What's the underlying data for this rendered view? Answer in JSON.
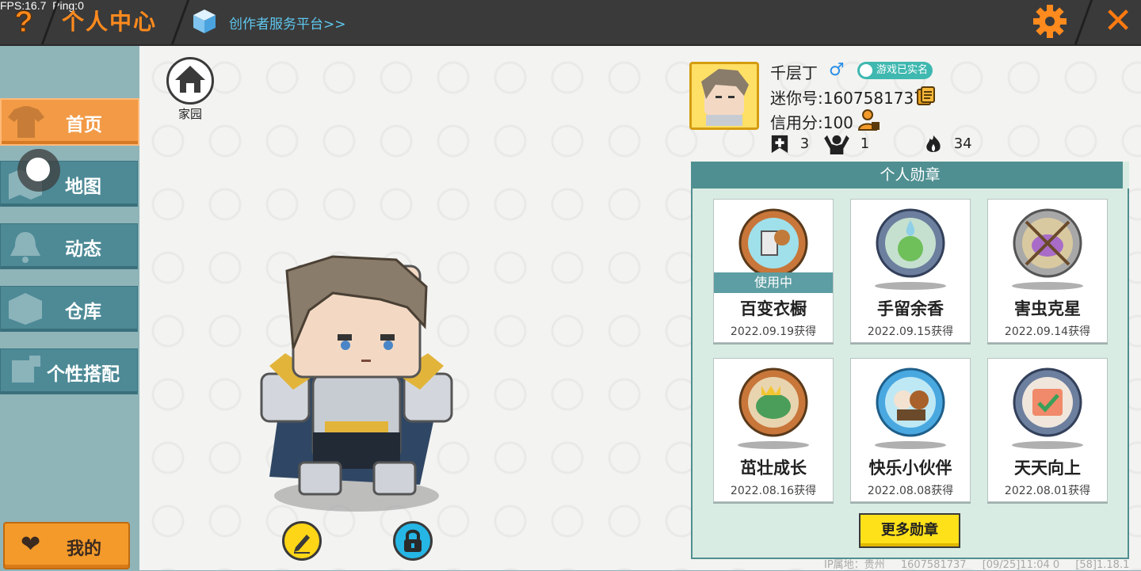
{
  "debug": {
    "fps": "FPS:16.7",
    "ping": "Ping:0"
  },
  "header": {
    "help_label": "?",
    "title": "个人中心",
    "creator_link": "创作者服务平台>>",
    "close_label": "✕"
  },
  "sidebar": {
    "items": [
      {
        "label": "首页",
        "icon": "shirt-icon",
        "active": true
      },
      {
        "label": "地图",
        "icon": "map-icon",
        "active": false
      },
      {
        "label": "动态",
        "icon": "bell-icon",
        "active": false
      },
      {
        "label": "仓库",
        "icon": "box-icon",
        "active": false
      },
      {
        "label": "个性搭配",
        "icon": "outfit-icon",
        "active": false
      }
    ],
    "my_label": "我的"
  },
  "stage": {
    "home_label": "家园",
    "edit_icon": "pencil-icon",
    "lock_icon": "lock-icon"
  },
  "profile": {
    "name": "千层丁",
    "gender_symbol": "♂",
    "verified_label": "游戏已实名",
    "uid": "迷你号:1607581737",
    "credit": "信用分:100",
    "stats": {
      "posts": "3",
      "fans": "1",
      "heat": "34"
    }
  },
  "badges": {
    "header": "个人勋章",
    "in_use_label": "使用中",
    "items": [
      {
        "name": "百变衣橱",
        "date": "2022.09.19获得",
        "in_use": true
      },
      {
        "name": "手留余香",
        "date": "2022.09.15获得",
        "in_use": false
      },
      {
        "name": "害虫克星",
        "date": "2022.09.14获得",
        "in_use": false
      },
      {
        "name": "茁壮成长",
        "date": "2022.08.16获得",
        "in_use": false
      },
      {
        "name": "快乐小伙伴",
        "date": "2022.08.08获得",
        "in_use": false
      },
      {
        "name": "天天向上",
        "date": "2022.08.01获得",
        "in_use": false
      }
    ],
    "more_label": "更多勋章"
  },
  "footer": {
    "ip": "IP属地：贵州",
    "uid": "1607581737",
    "time": "[09/25]11:04 0",
    "version": "[58]1.18.1"
  },
  "colors": {
    "accent": "#ff8a1d",
    "teal": "#4f8f91",
    "nav_active": "#f29a45",
    "nav": "#4d8a96",
    "yellow": "#ffe11a"
  }
}
